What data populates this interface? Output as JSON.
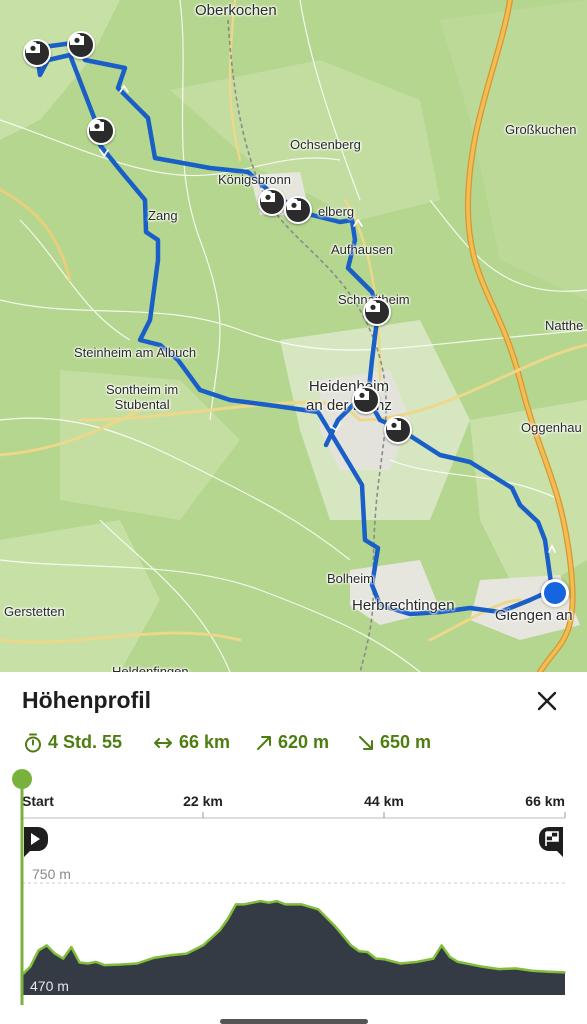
{
  "map": {
    "places": {
      "oberkochen": "Oberkochen",
      "grosskuchen": "Großkuchen",
      "ochsenberg": "Ochsenberg",
      "koenigsbronn": "Königsbronn",
      "itzelberg": "elberg",
      "zang": "Zang",
      "aufhausen": "Aufhausen",
      "schnaitheim": "Schnaitheim",
      "natth": "Natthe",
      "steinheim": "Steinheim am Albuch",
      "sontheim": "Sontheim im\nStubental",
      "heidenheim": "Heidenheim\nan der Brenz",
      "oggenhausen": "Oggenhau",
      "gerstetten": "Gerstetten",
      "bolheim": "Bolheim",
      "herbrechtingen": "Herbrechtingen",
      "giengen": "Giengen an",
      "heldenfingen": "Heldenfingen"
    },
    "photo_markers": 8,
    "route_color": "#1a5fc7",
    "map_green": "#a9cf82"
  },
  "panel": {
    "title": "Höhenprofil",
    "stats": {
      "duration": "4 Std. 55",
      "distance": "66 km",
      "ascent": "620 m",
      "descent": "650 m"
    },
    "axis": {
      "start_label": "Start",
      "ticks": [
        "22 km",
        "44 km",
        "66 km"
      ],
      "max_elevation": "750 m",
      "min_elevation": "470 m"
    },
    "accent": "#78b23c"
  },
  "chart_data": {
    "type": "area",
    "xlabel": "",
    "ylabel": "",
    "x_ticks": [
      "Start",
      "22 km",
      "44 km",
      "66 km"
    ],
    "y_ticks": [
      "750 m",
      "470 m"
    ],
    "xlim": [
      0,
      66
    ],
    "ylim": [
      470,
      750
    ],
    "x": [
      0,
      1,
      2,
      3,
      4,
      5,
      6,
      7,
      8,
      9,
      10,
      12,
      14,
      16,
      18,
      20,
      22,
      24,
      25,
      26,
      27,
      28,
      29,
      30,
      31,
      32,
      34,
      36,
      38,
      40,
      41,
      42,
      43,
      44,
      46,
      48,
      50,
      51,
      52,
      53,
      54,
      56,
      58,
      60,
      62,
      64,
      66
    ],
    "y": [
      470,
      495,
      545,
      560,
      535,
      520,
      555,
      508,
      505,
      510,
      500,
      502,
      505,
      522,
      530,
      535,
      560,
      605,
      640,
      685,
      685,
      690,
      695,
      690,
      695,
      685,
      685,
      670,
      620,
      560,
      542,
      540,
      520,
      518,
      505,
      510,
      520,
      560,
      525,
      510,
      505,
      495,
      488,
      490,
      483,
      480,
      478
    ]
  }
}
